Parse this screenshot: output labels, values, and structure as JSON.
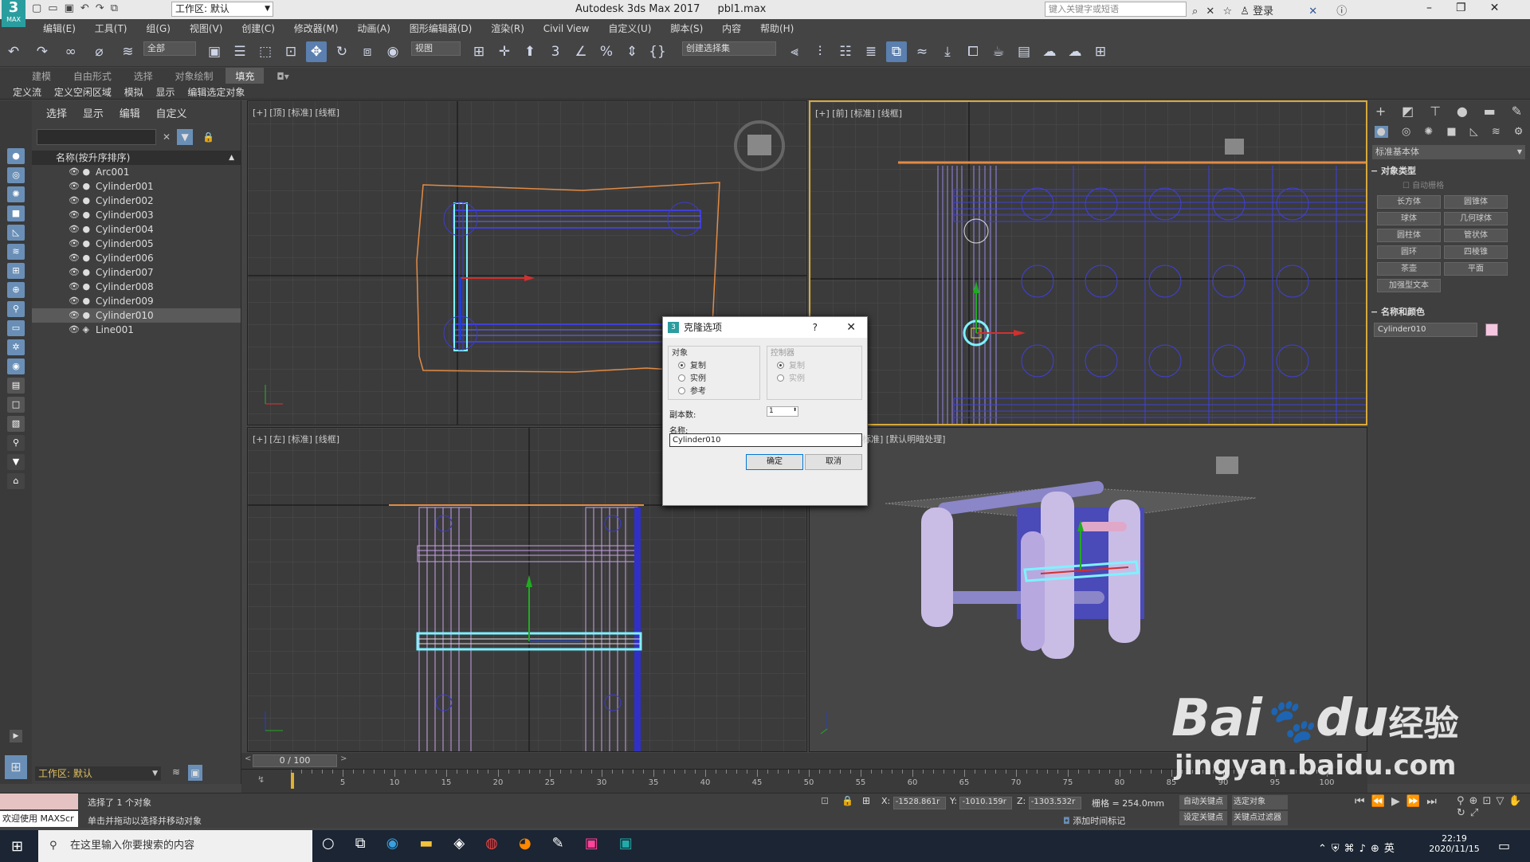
{
  "title_bar": {
    "app_title": "Autodesk 3ds Max 2017",
    "file_name": "pbl1.max",
    "workspace": "工作区: 默认",
    "search_placeholder": "键入关键字或短语",
    "login": "登录",
    "logo": "MAX"
  },
  "menu": [
    "编辑(E)",
    "工具(T)",
    "组(G)",
    "视图(V)",
    "创建(C)",
    "修改器(M)",
    "动画(A)",
    "图形编辑器(D)",
    "渲染(R)",
    "Civil View",
    "自定义(U)",
    "脚本(S)",
    "内容",
    "帮助(H)"
  ],
  "toolbar": {
    "select_filter": "全部",
    "ref_coord": "视图",
    "named_selection": "创建选择集"
  },
  "ribbon": {
    "tabs": [
      "建模",
      "自由形式",
      "选择",
      "对象绘制",
      "填充"
    ],
    "active_tab": "填充",
    "subtabs": [
      "定义流",
      "定义空闲区域",
      "模拟",
      "显示",
      "编辑选定对象"
    ]
  },
  "scene_explorer": {
    "tabs": [
      "选择",
      "显示",
      "编辑",
      "自定义"
    ],
    "header": "名称(按升序排序)",
    "items": [
      "Arc001",
      "Cylinder001",
      "Cylinder002",
      "Cylinder003",
      "Cylinder004",
      "Cylinder005",
      "Cylinder006",
      "Cylinder007",
      "Cylinder008",
      "Cylinder009",
      "Cylinder010",
      "Line001"
    ],
    "selected": "Cylinder010",
    "workspace": "工作区: 默认"
  },
  "viewports": {
    "top": "[+] [顶] [标准] [线框]",
    "front": "[+] [前] [标准] [线框]",
    "left": "[+] [左] [标准] [线框]",
    "persp": "标准] [默认明暗处理]"
  },
  "clone_dialog": {
    "title": "克隆选项",
    "help": "?",
    "object_group": "对象",
    "controller_group": "控制器",
    "object_options": [
      "复制",
      "实例",
      "参考"
    ],
    "controller_options": [
      "复制",
      "实例"
    ],
    "copies_label": "副本数:",
    "copies_value": "1",
    "name_label": "名称:",
    "name_value": "Cylinder010",
    "ok": "确定",
    "cancel": "取消"
  },
  "command_panel": {
    "category": "标准基本体",
    "rollout_object_type": "对象类型",
    "autogrid": "自动栅格",
    "buttons": [
      "长方体",
      "圆锥体",
      "球体",
      "几何球体",
      "圆柱体",
      "管状体",
      "圆环",
      "四棱锥",
      "茶壶",
      "平面",
      "加强型文本"
    ],
    "rollout_name_color": "名称和颜色",
    "object_name": "Cylinder010",
    "object_color": "#f5c6e0"
  },
  "timeline": {
    "frame": "0 / 100",
    "ticks": [
      "5",
      "10",
      "15",
      "20",
      "25",
      "30",
      "35",
      "40",
      "45",
      "50",
      "55",
      "60",
      "65",
      "70",
      "75",
      "80",
      "85",
      "90",
      "95",
      "100"
    ]
  },
  "status": {
    "maxscript": "欢迎使用 MAXScr",
    "selected": "选择了 1 个对象",
    "hint": "单击并拖动以选择并移动对象",
    "x_label": "X:",
    "x_value": "-1528.861r",
    "y_label": "Y:",
    "y_value": "-1010.159r",
    "z_label": "Z:",
    "z_value": "-1303.532r",
    "grid": "栅格 = 254.0mm",
    "add_time_tag": "添加时间标记",
    "auto_key": "自动关键点",
    "set_key": "设定关键点",
    "selected_obj": "选定对象",
    "key_filter": "关键点过滤器"
  },
  "taskbar": {
    "search": "在这里输入你要搜索的内容",
    "time": "22:19",
    "date": "2020/11/15",
    "ime": "英"
  },
  "watermark": {
    "brand": "Bai",
    "brand2": "du",
    "suffix": "经验",
    "url": "jingyan.baidu.com"
  }
}
